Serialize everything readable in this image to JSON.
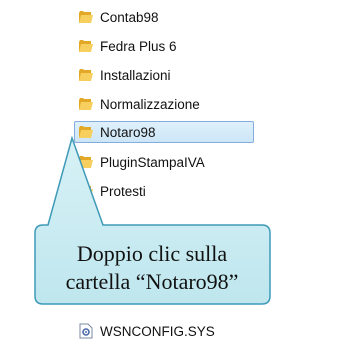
{
  "explorer": {
    "items": [
      {
        "label": "Contab98",
        "icon": "folder-icon"
      },
      {
        "label": "Fedra Plus 6",
        "icon": "folder-icon"
      },
      {
        "label": "Installazioni",
        "icon": "folder-icon"
      },
      {
        "label": "Normalizzazione",
        "icon": "folder-icon"
      },
      {
        "label": "Notaro98",
        "icon": "folder-icon",
        "selected": true
      },
      {
        "label": "PluginStampaIVA",
        "icon": "folder-icon"
      },
      {
        "label": "Protesti",
        "icon": "folder-icon"
      },
      {
        "label": "WSNCONFIG.SYS",
        "icon": "system-file-icon"
      }
    ]
  },
  "callout": {
    "line1": "Doppio clic sulla",
    "line2": "cartella “Notaro98”",
    "fill_color": "#c8ecf2",
    "border_color": "#3f9ab8"
  }
}
